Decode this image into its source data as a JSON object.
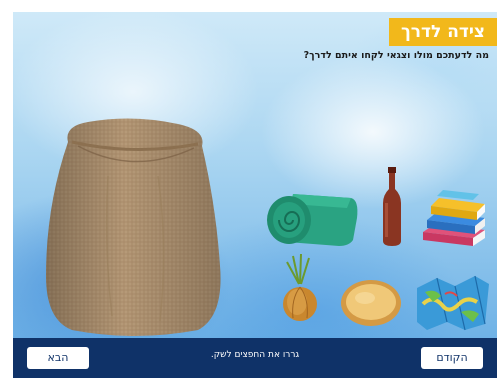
{
  "activity": {
    "title": "צידה לדרך",
    "question": "מה לדעתכם מולו וצגאי לקחו איתם לדרך?"
  },
  "items": [
    {
      "name": "sack",
      "icon": "sack-icon"
    },
    {
      "name": "blanket",
      "icon": "rolled-blanket-icon"
    },
    {
      "name": "bottle",
      "icon": "bottle-icon"
    },
    {
      "name": "books",
      "icon": "books-icon"
    },
    {
      "name": "onion",
      "icon": "onion-icon"
    },
    {
      "name": "pita",
      "icon": "pita-bread-icon"
    },
    {
      "name": "map",
      "icon": "map-icon"
    }
  ],
  "footer": {
    "next_label": "הבא",
    "prev_label": "הקודם",
    "instruction": "גררו את החפצים לשק."
  },
  "colors": {
    "accent": "#f2b81b",
    "footer_bg": "#0f3268"
  }
}
